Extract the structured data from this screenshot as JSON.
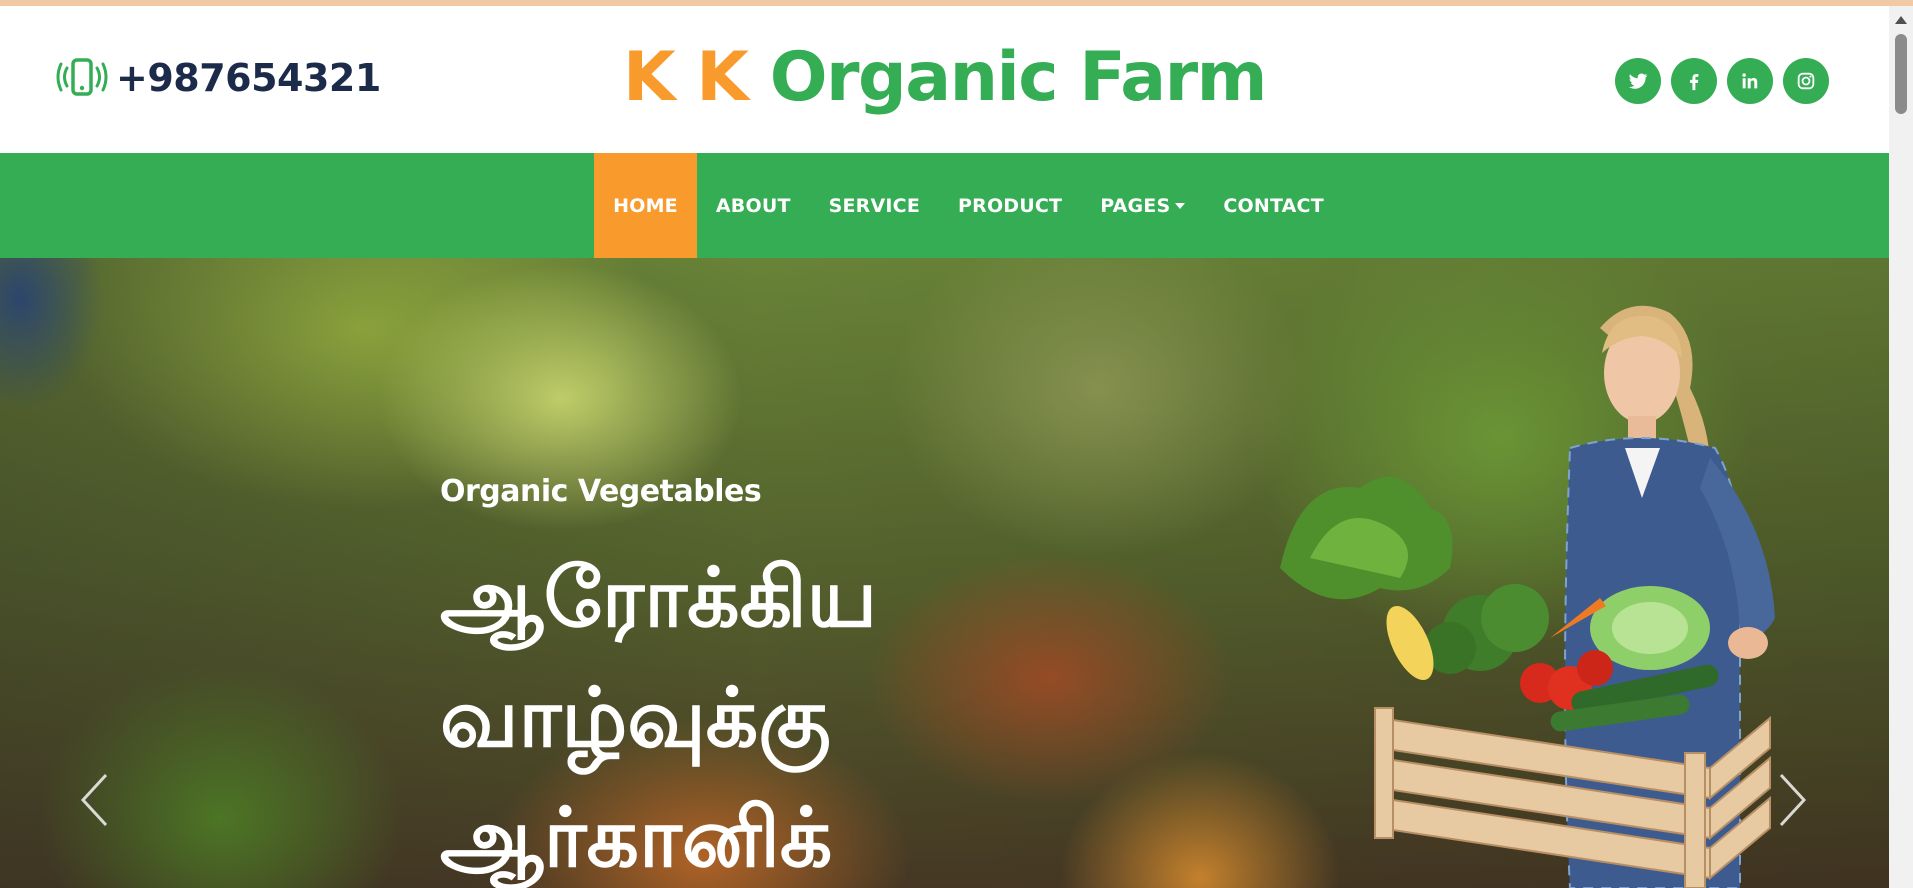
{
  "header": {
    "phone_icon": "mobile-vibrate-icon",
    "phone": "+987654321",
    "logo_kk": "K K",
    "logo_rest": "Organic Farm",
    "socials": [
      {
        "name": "twitter-icon"
      },
      {
        "name": "facebook-icon"
      },
      {
        "name": "linkedin-icon"
      },
      {
        "name": "instagram-icon"
      }
    ]
  },
  "nav": {
    "items": [
      {
        "label": "HOME",
        "active": true
      },
      {
        "label": "ABOUT"
      },
      {
        "label": "SERVICE"
      },
      {
        "label": "PRODUCT"
      },
      {
        "label": "PAGES",
        "dropdown": true
      },
      {
        "label": "CONTACT"
      }
    ]
  },
  "hero": {
    "subtitle": "Organic Vegetables",
    "title_lines": [
      "ஆரோக்கிய",
      "வாழ்வுக்கு",
      "ஆர்கானிக்"
    ],
    "prev_icon": "chevron-left-icon",
    "next_icon": "chevron-right-icon"
  },
  "colors": {
    "brand_green": "#34ad54",
    "brand_orange": "#f99a2c",
    "phone_text": "#1c2b49"
  }
}
